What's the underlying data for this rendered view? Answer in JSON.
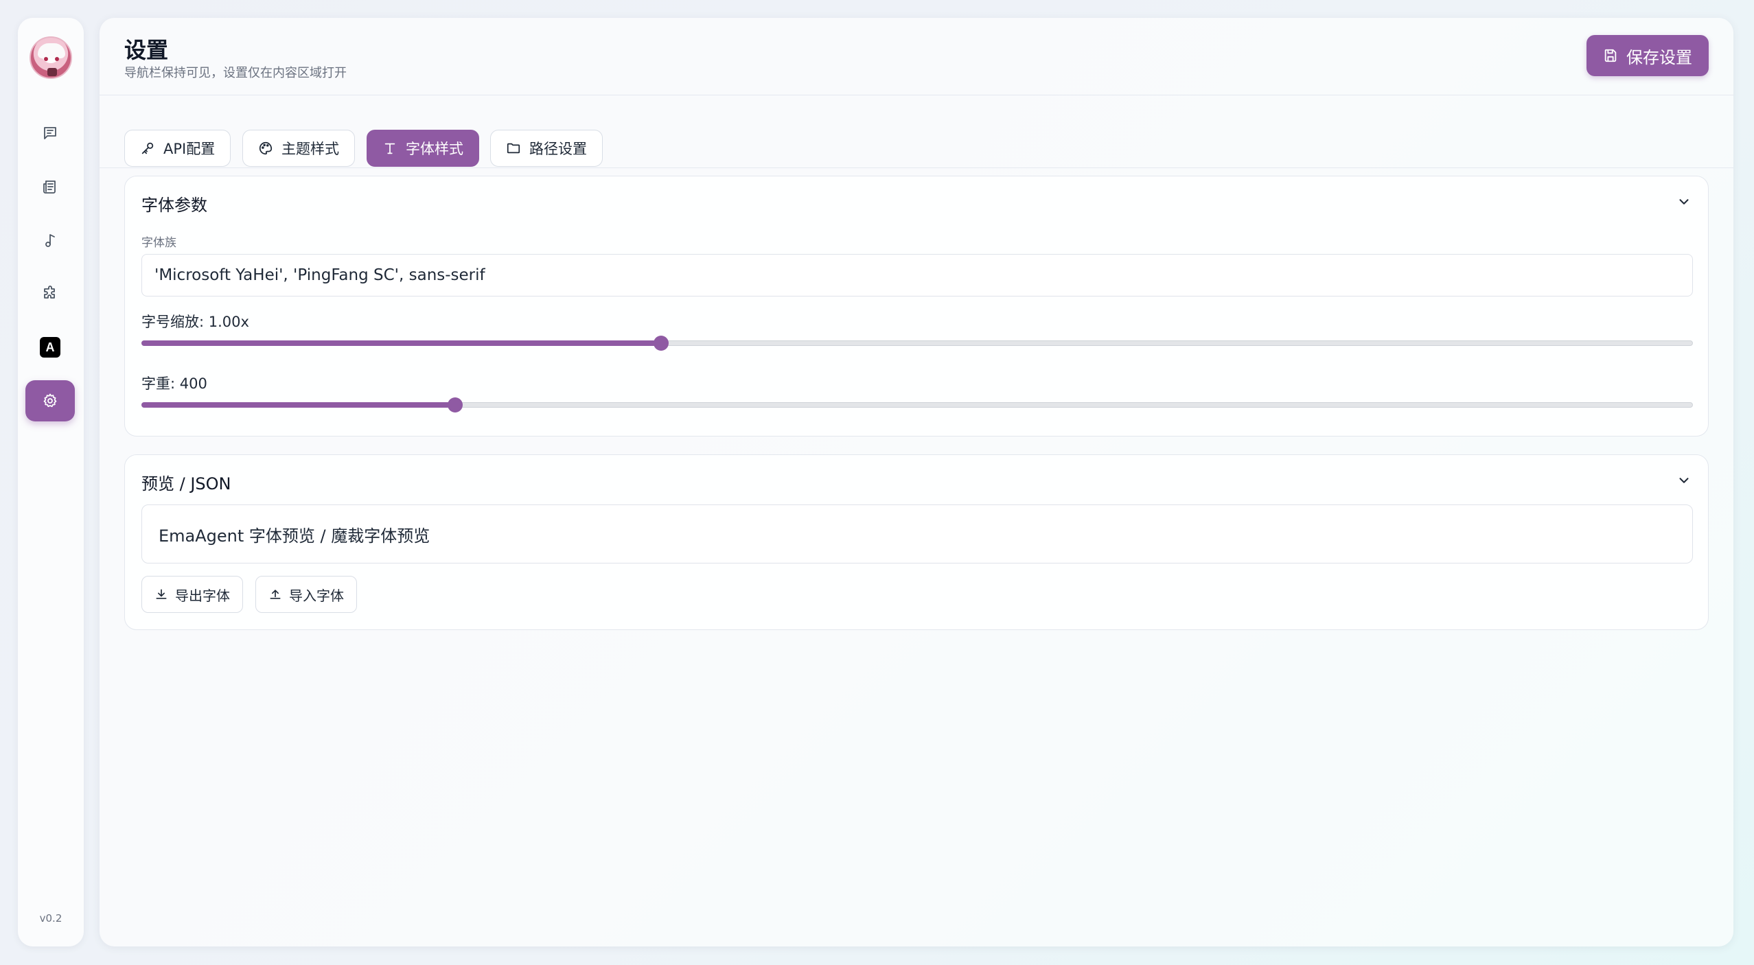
{
  "header": {
    "title": "设置",
    "subtitle": "导航栏保持可见，设置仅在内容区域打开",
    "save_label": "保存设置"
  },
  "sidebar": {
    "items": [
      {
        "name": "chat",
        "icon": "message-square-icon",
        "active": false
      },
      {
        "name": "news",
        "icon": "newspaper-icon",
        "active": false
      },
      {
        "name": "music",
        "icon": "music-note-icon",
        "active": false
      },
      {
        "name": "plugins",
        "icon": "puzzle-icon",
        "active": false
      },
      {
        "name": "font",
        "icon": "a-letter-icon",
        "badge": "A",
        "active": false
      },
      {
        "name": "settings",
        "icon": "gear-icon",
        "active": true
      }
    ],
    "version": "v0.2"
  },
  "tabs": [
    {
      "label": "API配置",
      "icon": "key-icon",
      "active": false
    },
    {
      "label": "主题样式",
      "icon": "palette-icon",
      "active": false
    },
    {
      "label": "字体样式",
      "icon": "type-icon",
      "active": true
    },
    {
      "label": "路径设置",
      "icon": "folder-icon",
      "active": false
    }
  ],
  "font_params": {
    "section_title": "字体参数",
    "family_label": "字体族",
    "family_value": "'Microsoft YaHei', 'PingFang SC', sans-serif",
    "scale_label": "字号缩放: 1.00x",
    "scale_fraction": 0.335,
    "weight_label": "字重: 400",
    "weight_fraction": 0.202
  },
  "preview": {
    "section_title": "预览 / JSON",
    "sample_text": "EmaAgent 字体预览 / 魔裁字体预览",
    "export_label": "导出字体",
    "import_label": "导入字体"
  },
  "colors": {
    "accent": "#8f5aa3",
    "background": "#eef1f7",
    "text": "#1f2937",
    "muted": "#6b7280"
  }
}
